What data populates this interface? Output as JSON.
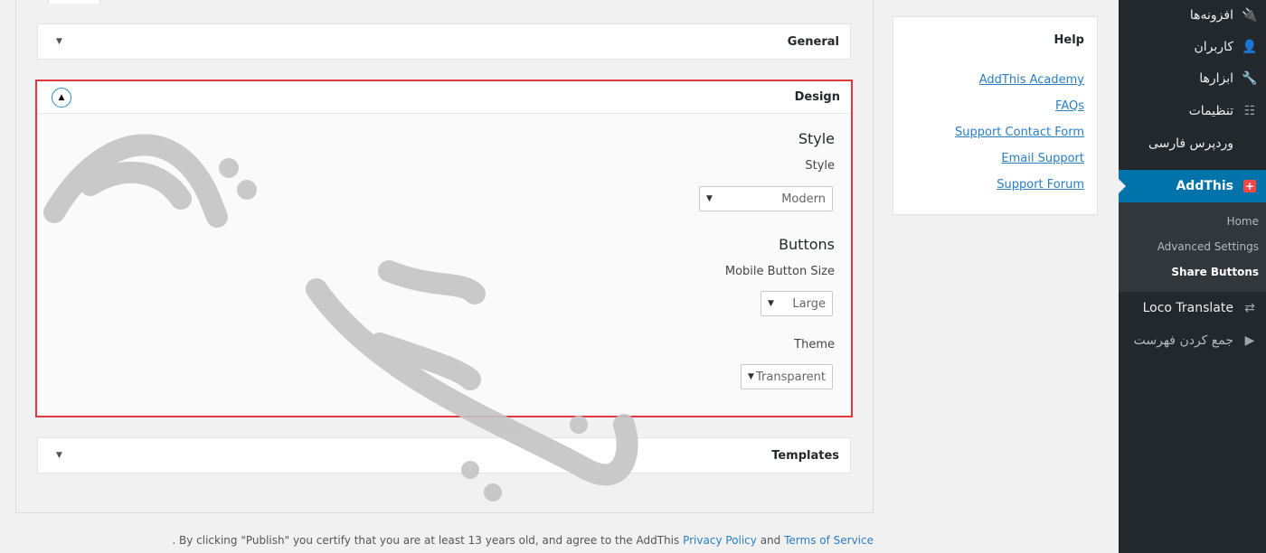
{
  "sections": {
    "general": {
      "title": "General"
    },
    "design": {
      "title": "Design",
      "style_group": "Style",
      "style_label": "Style",
      "style_value": "Modern",
      "buttons_group": "Buttons",
      "mobile_size_label": "Mobile Button Size",
      "mobile_size_value": "Large",
      "theme_label": "Theme",
      "theme_value": "Transparent"
    },
    "templates": {
      "title": "Templates"
    }
  },
  "footer": {
    "text_before": ". By clicking \"Publish\" you certify that you are at least 13 years old, and agree to the AddThis",
    "privacy_link": "Privacy Policy",
    "and": "and",
    "terms_link": "Terms of Service"
  },
  "help": {
    "title": "Help",
    "links": [
      "AddThis Academy",
      "FAQs",
      "Support Contact Form",
      "Email Support",
      "Support Forum"
    ]
  },
  "sidebar": {
    "items": [
      {
        "label": "افزونه‌ها",
        "icon": "plugin-icon"
      },
      {
        "label": "کاربران",
        "icon": "user-icon"
      },
      {
        "label": "ابزارها",
        "icon": "wrench-icon"
      },
      {
        "label": "تنظیمات",
        "icon": "settings-sliders-icon"
      },
      {
        "label": "وردپرس فارسی",
        "icon": ""
      },
      {
        "label": "AddThis",
        "icon": "addthis-plus-icon"
      }
    ],
    "submenu": [
      "Home",
      "Advanced Settings",
      "Share Buttons"
    ],
    "after": [
      {
        "label": "Loco Translate",
        "icon": "translate-icon"
      },
      {
        "label": "جمع کردن فهرست",
        "icon": "collapse-menu-icon"
      }
    ]
  },
  "colors": {
    "accent": "#0073aa",
    "highlight_border": "#e0383e",
    "link": "#2a7ec4",
    "sidebar_bg": "#23282d"
  }
}
